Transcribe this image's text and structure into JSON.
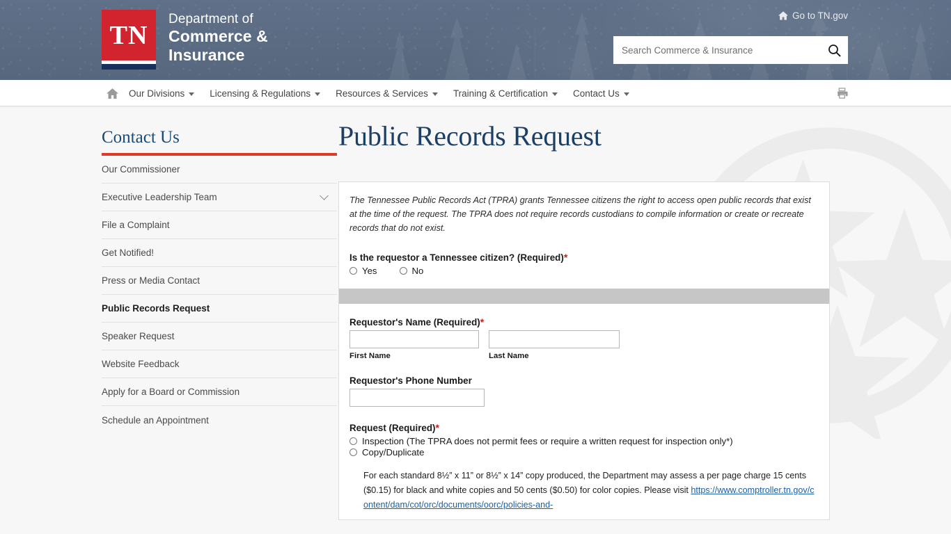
{
  "header": {
    "agency_line1": "Department of",
    "agency_line2": "Commerce &",
    "agency_line3": "Insurance",
    "logo_text": "TN",
    "tngov_link": "Go to TN.gov",
    "home_icon": "home-icon",
    "search_placeholder": "Search Commerce & Insurance",
    "search_value": "",
    "search_icon": "search-icon",
    "colors": {
      "red": "#d1242f",
      "navy": "#16325c",
      "header_blue": "#5a6b82"
    }
  },
  "nav": {
    "home_icon": "home-icon",
    "print_icon": "printer-icon",
    "items": [
      {
        "label": "Our Divisions",
        "has_caret": true
      },
      {
        "label": "Licensing & Regulations",
        "has_caret": true
      },
      {
        "label": "Resources & Services",
        "has_caret": true
      },
      {
        "label": "Training & Certification",
        "has_caret": true
      },
      {
        "label": "Contact Us",
        "has_caret": true
      }
    ]
  },
  "sidebar": {
    "title": "Contact Us",
    "accent_color": "#e03a27",
    "items": [
      {
        "label": "Our Commissioner",
        "active": false,
        "chevron": false
      },
      {
        "label": "Executive Leadership Team",
        "active": false,
        "chevron": true
      },
      {
        "label": "File a Complaint",
        "active": false,
        "chevron": false
      },
      {
        "label": "Get Notified!",
        "active": false,
        "chevron": false
      },
      {
        "label": "Press or Media Contact",
        "active": false,
        "chevron": false
      },
      {
        "label": "Public Records Request",
        "active": true,
        "chevron": false
      },
      {
        "label": "Speaker Request",
        "active": false,
        "chevron": false
      },
      {
        "label": "Website Feedback",
        "active": false,
        "chevron": false
      },
      {
        "label": "Apply for a Board or Commission",
        "active": false,
        "chevron": false
      },
      {
        "label": "Schedule an Appointment",
        "active": false,
        "chevron": false
      }
    ]
  },
  "main": {
    "page_title": "Public Records Request",
    "intro": "The Tennessee Public Records Act (TPRA) grants Tennessee citizens the right to access open public records that exist at the time of the request. The TPRA does not require records custodians to compile information or create or recreate records that do not exist.",
    "citizen_question": {
      "label": "Is the requestor a Tennessee citizen? (Required)",
      "required_marker": "*",
      "options": [
        {
          "label": "Yes",
          "selected": false
        },
        {
          "label": "No",
          "selected": false
        }
      ]
    },
    "requestor_name": {
      "label": "Requestor's Name (Required)",
      "required_marker": "*",
      "first_name": {
        "value": "",
        "sub_label": "First Name"
      },
      "last_name": {
        "value": "",
        "sub_label": "Last Name"
      }
    },
    "phone": {
      "label": "Requestor's Phone Number",
      "value": ""
    },
    "request_type": {
      "label": "Request (Required)",
      "required_marker": "*",
      "options": [
        {
          "label": "Inspection (The TPRA does not permit fees or require a written request for inspection only*)",
          "selected": false
        },
        {
          "label": "Copy/Duplicate",
          "selected": false
        }
      ]
    },
    "fee_note": {
      "text_before": "For each standard 8½” x 11” or 8½” x 14” copy produced, the Department may assess a per page charge 15 cents ($0.15) for black and white copies and 50 cents ($0.50) for color copies. Please visit ",
      "link_text": "https://www.comptroller.tn.gov/content/dam/cot/orc/documents/oorc/policies-and-"
    }
  }
}
